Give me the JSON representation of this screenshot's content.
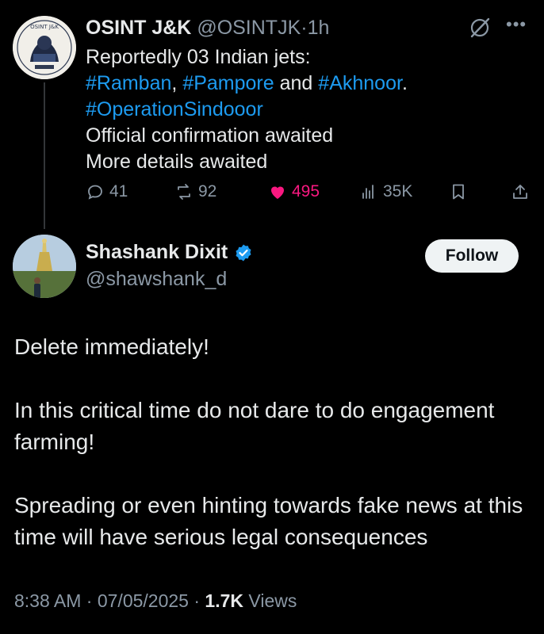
{
  "quoted_tweet": {
    "avatar_text": "OSINT J&K",
    "author_name": "OSINT J&K",
    "author_handle": "@OSINTJK",
    "separator": "·",
    "time_ago": "1h",
    "more_icon": "more-icon",
    "grok_icon": "grok-icon",
    "lines": {
      "line1": "Reportedly 03 Indian jets:",
      "tag1": "#Ramban",
      "comma": ",",
      "tag2": "#Pampore",
      "and": "and",
      "tag3": "#Akhnoor",
      "period": ".",
      "tag4": "#OperationSindooor",
      "line4": "Official confirmation awaited",
      "line5": "More details awaited"
    },
    "actions": {
      "replies": "41",
      "reposts": "92",
      "likes": "495",
      "views": "35K"
    },
    "colors": {
      "hashtag": "#1d9bf0",
      "like": "#f91880",
      "muted": "#8b98a5"
    }
  },
  "main_tweet": {
    "author_name": "Shashank Dixit",
    "author_handle": "@shawshank_d",
    "verified": true,
    "follow_label": "Follow",
    "paragraphs": {
      "p1": "Delete immediately!",
      "p2": "In this critical time do not dare to do engagement farming!",
      "p3": "Spreading or even hinting towards fake news at this time will have serious legal consequences"
    },
    "meta": {
      "time": "8:38 AM",
      "sep1": "·",
      "date": "07/05/2025",
      "sep2": "·",
      "views_count": "1.7K",
      "views_label": "Views"
    },
    "colors": {
      "verified": "#1d9bf0",
      "follow_bg": "#eff3f4"
    }
  }
}
